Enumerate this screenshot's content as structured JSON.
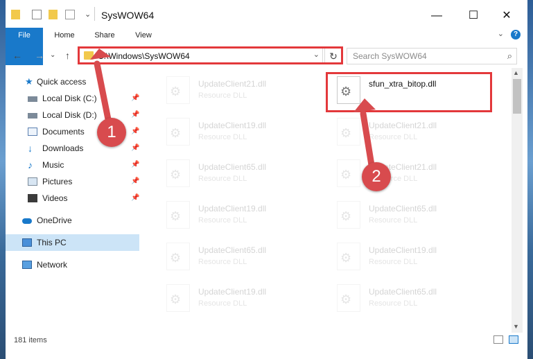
{
  "window": {
    "title": "SysWOW64",
    "minimize_glyph": "—",
    "maximize_glyph": "☐",
    "close_glyph": "✕"
  },
  "ribbon": {
    "tabs": [
      "File",
      "Home",
      "Share",
      "View"
    ],
    "help_glyph": "?",
    "expand_glyph": "⌄"
  },
  "address": {
    "path": "C:\\Windows\\SysWOW64",
    "dropdown_glyph": "⌄",
    "refresh_glyph": "↻"
  },
  "search": {
    "placeholder": "Search SysWOW64"
  },
  "nav": {
    "back_glyph": "←",
    "forward_glyph": "→",
    "recent_glyph": "⌄",
    "up_glyph": "↑",
    "items": [
      {
        "label": "Quick access",
        "icon": "star-icon",
        "pinned": false
      },
      {
        "label": "Local Disk (C:)",
        "icon": "drive-icon",
        "pinned": true
      },
      {
        "label": "Local Disk (D:)",
        "icon": "drive-icon",
        "pinned": true
      },
      {
        "label": "Documents",
        "icon": "documents-icon",
        "pinned": true
      },
      {
        "label": "Downloads",
        "icon": "download-icon",
        "pinned": true
      },
      {
        "label": "Music",
        "icon": "music-icon",
        "pinned": true
      },
      {
        "label": "Pictures",
        "icon": "pictures-icon",
        "pinned": true
      },
      {
        "label": "Videos",
        "icon": "videos-icon",
        "pinned": true
      },
      {
        "label": "OneDrive",
        "icon": "onedrive-icon",
        "pinned": false
      },
      {
        "label": "This PC",
        "icon": "pc-icon",
        "pinned": false
      },
      {
        "label": "Network",
        "icon": "network-icon",
        "pinned": false
      }
    ],
    "pin_glyph": "📌"
  },
  "files": {
    "left": [
      {
        "name": "UpdateClient21.dll",
        "type": "Resource DLL"
      },
      {
        "name": "UpdateClient19.dll",
        "type": "Resource DLL"
      },
      {
        "name": "UpdateClient65.dll",
        "type": "Resource DLL"
      },
      {
        "name": "UpdateClient19.dll",
        "type": "Resource DLL"
      },
      {
        "name": "UpdateClient65.dll",
        "type": "Resource DLL"
      },
      {
        "name": "UpdateClient19.dll",
        "type": "Resource DLL"
      }
    ],
    "right": [
      {
        "name": "sfun_xtra_bitop.dll",
        "type": ""
      },
      {
        "name": "UpdateClient21.dll",
        "type": "Resource DLL"
      },
      {
        "name": "UpdateClient21.dll",
        "type": "Resource DLL"
      },
      {
        "name": "UpdateClient65.dll",
        "type": "Resource DLL"
      },
      {
        "name": "UpdateClient19.dll",
        "type": "Resource DLL"
      },
      {
        "name": "UpdateClient65.dll",
        "type": "Resource DLL"
      }
    ],
    "gear_glyph": "⚙"
  },
  "status": {
    "count": "181 items"
  },
  "scrollbar": {
    "up_glyph": "▲",
    "down_glyph": "▼"
  },
  "callouts": [
    "1",
    "2"
  ],
  "colors": {
    "accent": "#1979ca",
    "highlight": "#e3383b",
    "selected": "#cce4f7",
    "badge": "#d84b4e"
  }
}
